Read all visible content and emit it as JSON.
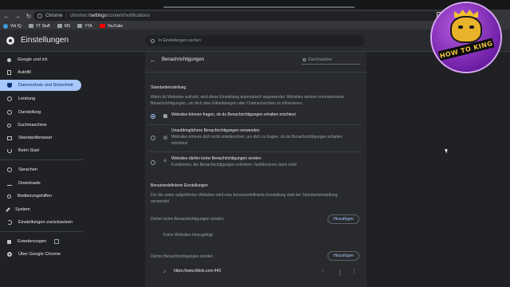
{
  "browser": {
    "origin_label": "Chrome",
    "url_prefix": "chrome://",
    "url_bold": "settings",
    "url_suffix": "/content/notifications",
    "bookmarks": [
      "Vid IQ",
      "YT Stuff",
      "MS",
      "YTA",
      "YouTube"
    ]
  },
  "settings": {
    "title": "Einstellungen",
    "search_placeholder": "In Einstellungen suchen"
  },
  "sidebar": {
    "items": [
      {
        "label": "Google und ich",
        "icon": "person-icon"
      },
      {
        "label": "Autofill",
        "icon": "autofill-icon"
      },
      {
        "label": "Datenschutz und Sicherheit",
        "icon": "shield-icon",
        "active": true
      },
      {
        "label": "Leistung",
        "icon": "gauge-icon"
      },
      {
        "label": "Darstellung",
        "icon": "palette-icon"
      },
      {
        "label": "Suchmaschine",
        "icon": "search-icon"
      },
      {
        "label": "Standardbrowser",
        "icon": "browser-icon"
      },
      {
        "label": "Beim Start",
        "icon": "power-icon"
      },
      {
        "label": "Sprachen",
        "icon": "globe-icon"
      },
      {
        "label": "Downloads",
        "icon": "download-icon"
      },
      {
        "label": "Bedienungshilfen",
        "icon": "accessibility-icon"
      },
      {
        "label": "System",
        "icon": "wrench-icon"
      },
      {
        "label": "Einstellungen zurücksetzen",
        "icon": "reset-icon"
      },
      {
        "label": "Erweiterungen",
        "icon": "puzzle-icon"
      },
      {
        "label": "Über Google Chrome",
        "icon": "chrome-icon"
      }
    ]
  },
  "page": {
    "title": "Benachrichtigungen",
    "search_placeholder": "Durchsuchen",
    "default_section": "Standardeinstellung",
    "default_desc_1": "Wenn du Websites aufrufst, wird diese Einstellung automatisch angewendet. Websites senden normalerweise",
    "default_desc_2": "Benachrichtigungen, um dich über Eilmeldungen oder Chatnachrichten zu informieren.",
    "options": [
      {
        "label": "Websites können fragen, ob du Benachrichtigungen erhalten möchtest",
        "desc": [],
        "selected": true
      },
      {
        "label": "Unaufdringlichere Benachrichtigungen verwenden",
        "desc": [
          "Websites können dich nicht unterbrechen, um dich zu fragen, ob du Benachrichtigungen erhalten",
          "möchtest"
        ],
        "selected": false
      },
      {
        "label": "Websites dürfen keine Benachrichtigungen senden",
        "desc": [
          "Funktionen, die Benachrichtigungen erfordern, funktionieren dann nicht"
        ],
        "selected": false
      }
    ],
    "custom_section": "Benutzerdefinierte Einstellungen",
    "custom_desc_1": "Für die unten aufgeführten Websites wird eine benutzerdefinierte Einstellung statt der Standardeinstellung",
    "custom_desc_2": "verwendet",
    "blocked_label": "Dürfen keine Benachrichtigungen senden",
    "add_label": "Hinzufügen",
    "no_sites": "Keine Websites hinzugefügt",
    "allowed_label": "Dürfen Benachrichtigungen senden",
    "allowed_sites": [
      "https://www.tiktok.com:443"
    ]
  },
  "overlay": {
    "logo_text": "HOW TO KING"
  }
}
